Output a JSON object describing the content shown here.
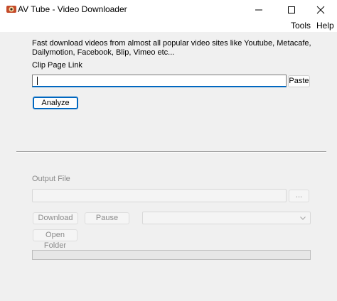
{
  "window": {
    "title": "AV Tube - Video Downloader",
    "icon": "av-tube-app-icon",
    "controls": [
      "minimize-icon",
      "maximize-icon",
      "close-icon"
    ]
  },
  "menu": {
    "items": [
      {
        "label": "Tools"
      },
      {
        "label": "Help"
      }
    ]
  },
  "main": {
    "description": "Fast download videos from almost all popular video sites like Youtube, Metacafe, Dailymotion, Facebook, Blip, Vimeo etc...",
    "link_label": "Clip Page Link",
    "link_value": "",
    "paste_label": "Paste",
    "analyze_label": "Analyze"
  },
  "output": {
    "label": "Output File",
    "value": "",
    "browse_label": "...",
    "download_label": "Download",
    "pause_label": "Pause",
    "format_value": "",
    "open_folder_label": "Open Folder",
    "progress": 0
  },
  "colors": {
    "accent": "#0067c0",
    "background": "#f0f0f0",
    "disabled_text": "#8a8a8a"
  }
}
